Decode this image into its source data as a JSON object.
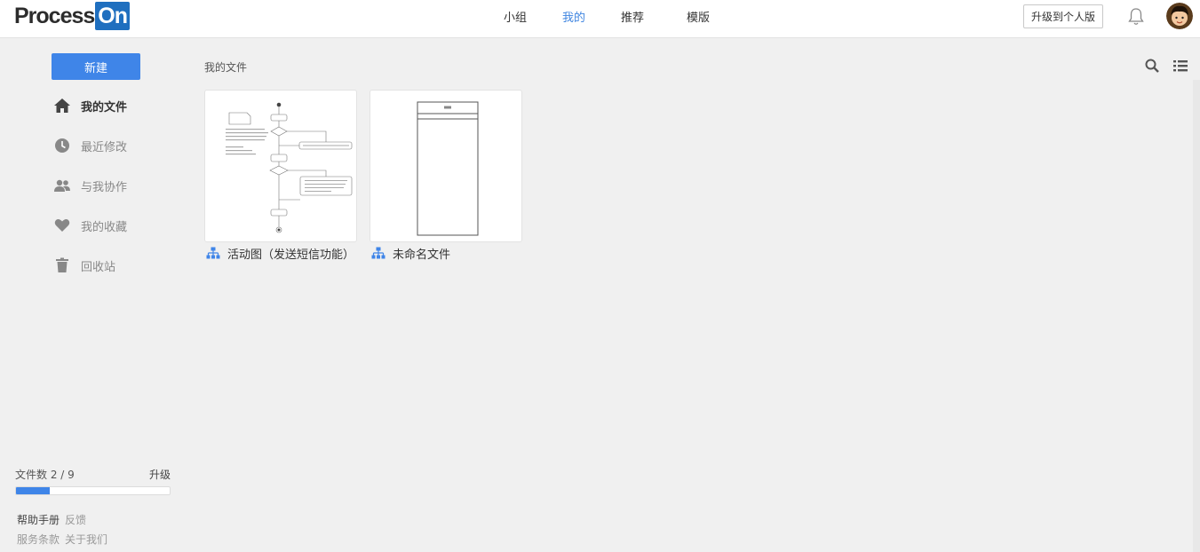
{
  "header": {
    "logo_text": "Process",
    "logo_badge": "On",
    "nav": [
      {
        "label": "小组",
        "active": false
      },
      {
        "label": "我的",
        "active": true
      },
      {
        "label": "推荐",
        "active": false
      },
      {
        "label": "模版",
        "active": false
      }
    ],
    "upgrade_label": "升级到个人版"
  },
  "sidebar": {
    "new_label": "新建",
    "items": [
      {
        "label": "我的文件",
        "icon": "home-icon",
        "active": true
      },
      {
        "label": "最近修改",
        "icon": "clock-icon",
        "active": false
      },
      {
        "label": "与我协作",
        "icon": "people-icon",
        "active": false
      },
      {
        "label": "我的收藏",
        "icon": "heart-icon",
        "active": false
      },
      {
        "label": "回收站",
        "icon": "trash-icon",
        "active": false
      }
    ],
    "quota": {
      "label": "文件数 2 / 9",
      "used": 2,
      "total": 9,
      "upgrade_label": "升级"
    },
    "footer": {
      "help": "帮助手册",
      "feedback": "反馈",
      "terms": "服务条款",
      "about": "关于我们"
    }
  },
  "main": {
    "breadcrumb": "我的文件",
    "tools": {
      "search_icon": "search-icon",
      "list_icon": "list-view-icon"
    },
    "files": [
      {
        "name": "活动图（发送短信功能）",
        "icon": "diagram-icon"
      },
      {
        "name": "未命名文件",
        "icon": "diagram-icon"
      }
    ]
  },
  "colors": {
    "accent": "#3f85e8",
    "active_nav": "#3f85e0",
    "logo_badge": "#1f6fbf"
  }
}
